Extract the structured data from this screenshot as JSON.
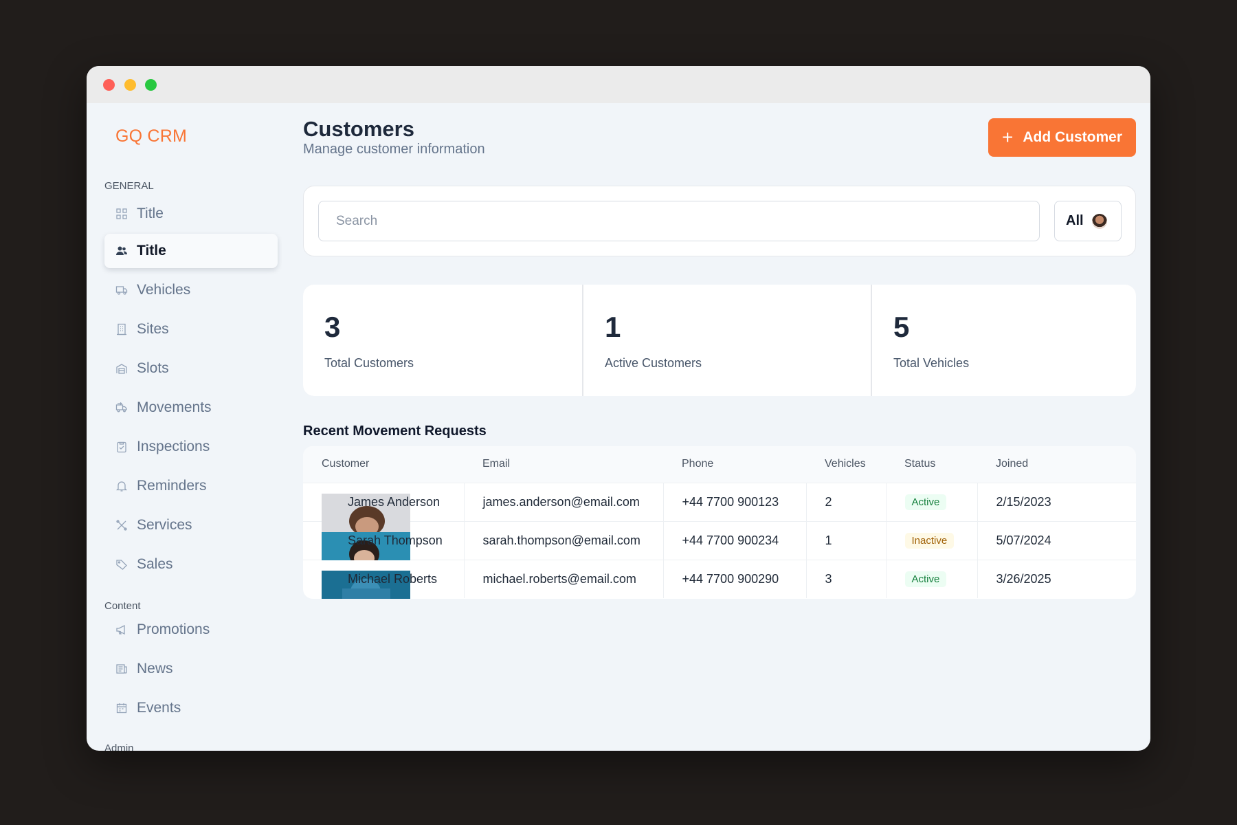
{
  "brand": "GQ CRM",
  "sidebar": {
    "sections": {
      "general": "GENERAL",
      "content": "Content",
      "admin": "Admin"
    },
    "items": [
      {
        "label": "Title",
        "icon": "dashboard-grid-icon"
      },
      {
        "label": "Title",
        "icon": "users-icon",
        "active": true
      },
      {
        "label": "Vehicles",
        "icon": "truck-icon"
      },
      {
        "label": "Sites",
        "icon": "building-icon"
      },
      {
        "label": "Slots",
        "icon": "garage-icon"
      },
      {
        "label": "Movements",
        "icon": "transfer-truck-icon"
      },
      {
        "label": "Inspections",
        "icon": "clipboard-check-icon"
      },
      {
        "label": "Reminders",
        "icon": "bell-icon"
      },
      {
        "label": "Services",
        "icon": "tools-icon"
      },
      {
        "label": "Sales",
        "icon": "tag-icon"
      },
      {
        "label": "Promotions",
        "icon": "megaphone-icon"
      },
      {
        "label": "News",
        "icon": "newspaper-icon"
      },
      {
        "label": "Events",
        "icon": "calendar-icon"
      }
    ]
  },
  "header": {
    "title": "Customers",
    "subtitle": "Manage customer information",
    "add_button": "Add Customer"
  },
  "search": {
    "placeholder": "Search",
    "filter_value": "All"
  },
  "stats": [
    {
      "value": "3",
      "label": "Total Customers"
    },
    {
      "value": "1",
      "label": "Active Customers"
    },
    {
      "value": "5",
      "label": "Total Vehicles"
    }
  ],
  "table": {
    "title": "Recent Movement Requests",
    "columns": [
      "Customer",
      "Email",
      "Phone",
      "Vehicles",
      "Status",
      "Joined"
    ],
    "rows": [
      {
        "customer": "James Anderson",
        "email": "james.anderson@email.com",
        "phone": "+44 7700 900123",
        "vehicles": "2",
        "status": "Active",
        "joined": "2/15/2023"
      },
      {
        "customer": "Sarah Thompson",
        "email": "sarah.thompson@email.com",
        "phone": "+44 7700 900234",
        "vehicles": "1",
        "status": "Inactive",
        "joined": "5/07/2024"
      },
      {
        "customer": "Michael Roberts",
        "email": "michael.roberts@email.com",
        "phone": "+44 7700 900290",
        "vehicles": "3",
        "status": "Active",
        "joined": "3/26/2025"
      }
    ]
  },
  "colors": {
    "accent": "#f97535",
    "active_badge": "#15803d",
    "inactive_badge": "#a16207"
  }
}
